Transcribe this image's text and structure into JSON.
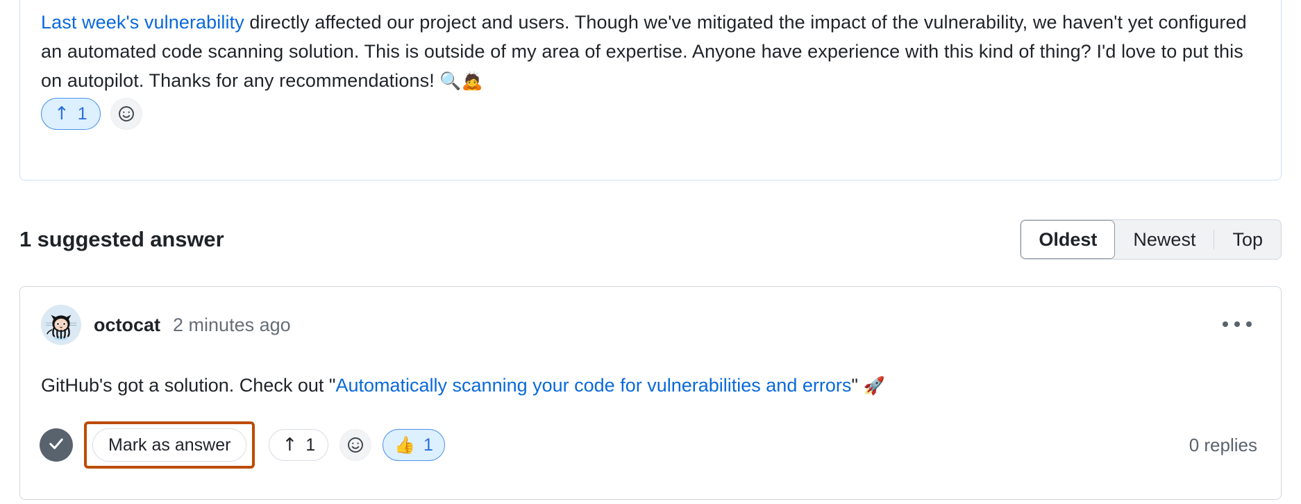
{
  "discussion_post": {
    "link_text": "Last week's vulnerability",
    "text_part1": " directly affected our project and users. Though we've mitigated the impact of the vulnerability, we haven't yet configured an automated code scanning solution. This is outside of my area of expertise. Anyone have experience with this kind of thing? I'd love to put this on autopilot. Thanks for any recommendations! ",
    "emoji_magnifier": "🔍",
    "emoji_bowing": "🙇",
    "upvote_count": "1",
    "upvote_arrow": "↑"
  },
  "answers_section": {
    "title": "1 suggested answer",
    "sort": {
      "options": [
        "Oldest",
        "Newest",
        "Top"
      ],
      "selected": "Oldest"
    }
  },
  "answer": {
    "author": "octocat",
    "timestamp": "2 minutes ago",
    "text_before_link": "GitHub's got a solution. Check out \"",
    "link_text": "Automatically scanning your code for vulnerabilities and errors",
    "text_after_link": "\" ",
    "emoji_rocket": "🚀",
    "mark_as_answer_label": "Mark as answer",
    "upvote_arrow": "↑",
    "upvote_count": "1",
    "thumbsup_emoji": "👍",
    "thumbsup_count": "1",
    "replies_label": "0 replies"
  },
  "colors": {
    "link": "#0969da",
    "accent_blue": "#2a6ee0",
    "reaction_bg": "#ddf0ff",
    "highlight_orange": "#bc4c00",
    "muted_text": "#656d76",
    "card_border": "#d0d7de",
    "post_border": "#c8e1ff"
  }
}
